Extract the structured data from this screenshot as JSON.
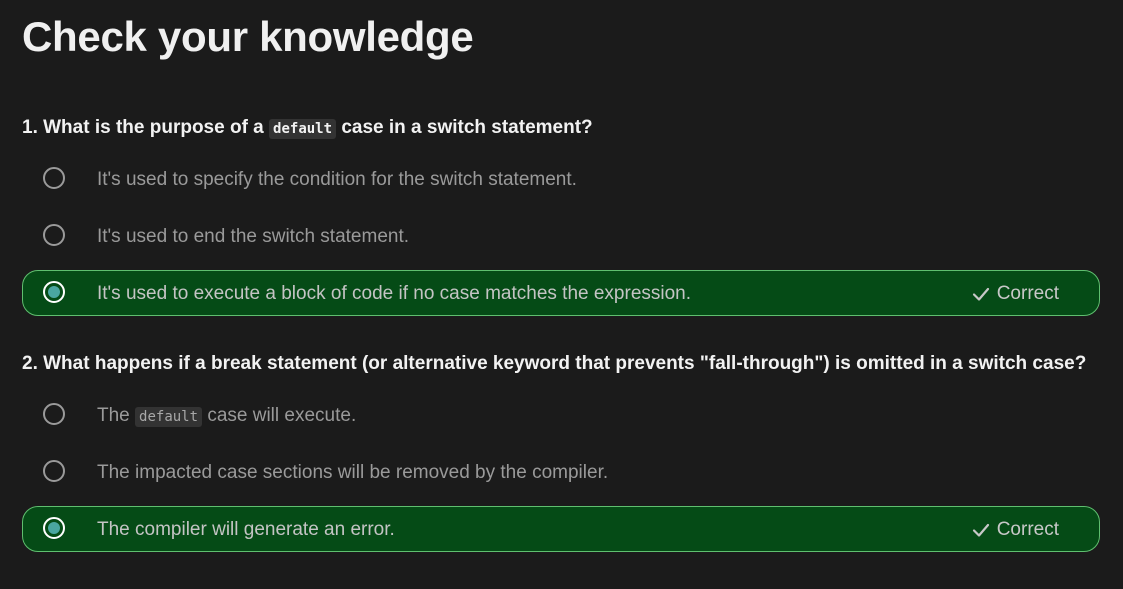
{
  "page": {
    "title": "Check your knowledge"
  },
  "questions": [
    {
      "prefix": "1. What is the purpose of a ",
      "code": "default",
      "suffix": " case in a switch statement?",
      "options": [
        {
          "text": "It's used to specify the condition for the switch statement.",
          "selected": false
        },
        {
          "text": "It's used to end the switch statement.",
          "selected": false
        },
        {
          "text": "It's used to execute a block of code if no case matches the expression.",
          "selected": true,
          "result": "Correct"
        }
      ]
    },
    {
      "prefix": "2. What happens if a break statement (or alternative keyword that prevents \"fall-through\") is omitted in a switch case?",
      "options": [
        {
          "text_prefix": "The ",
          "code": "default",
          "text_suffix": " case will execute.",
          "selected": false
        },
        {
          "text": "The impacted case sections will be removed by the compiler.",
          "selected": false
        },
        {
          "text": "The compiler will generate an error.",
          "selected": true,
          "result": "Correct"
        }
      ]
    }
  ],
  "colors": {
    "background": "#1b1b1b",
    "correct_bg": "#054b16",
    "correct_border": "#5fbf6f",
    "radio_fill": "#4aa6a0"
  },
  "icons": {
    "check": "check-icon"
  }
}
